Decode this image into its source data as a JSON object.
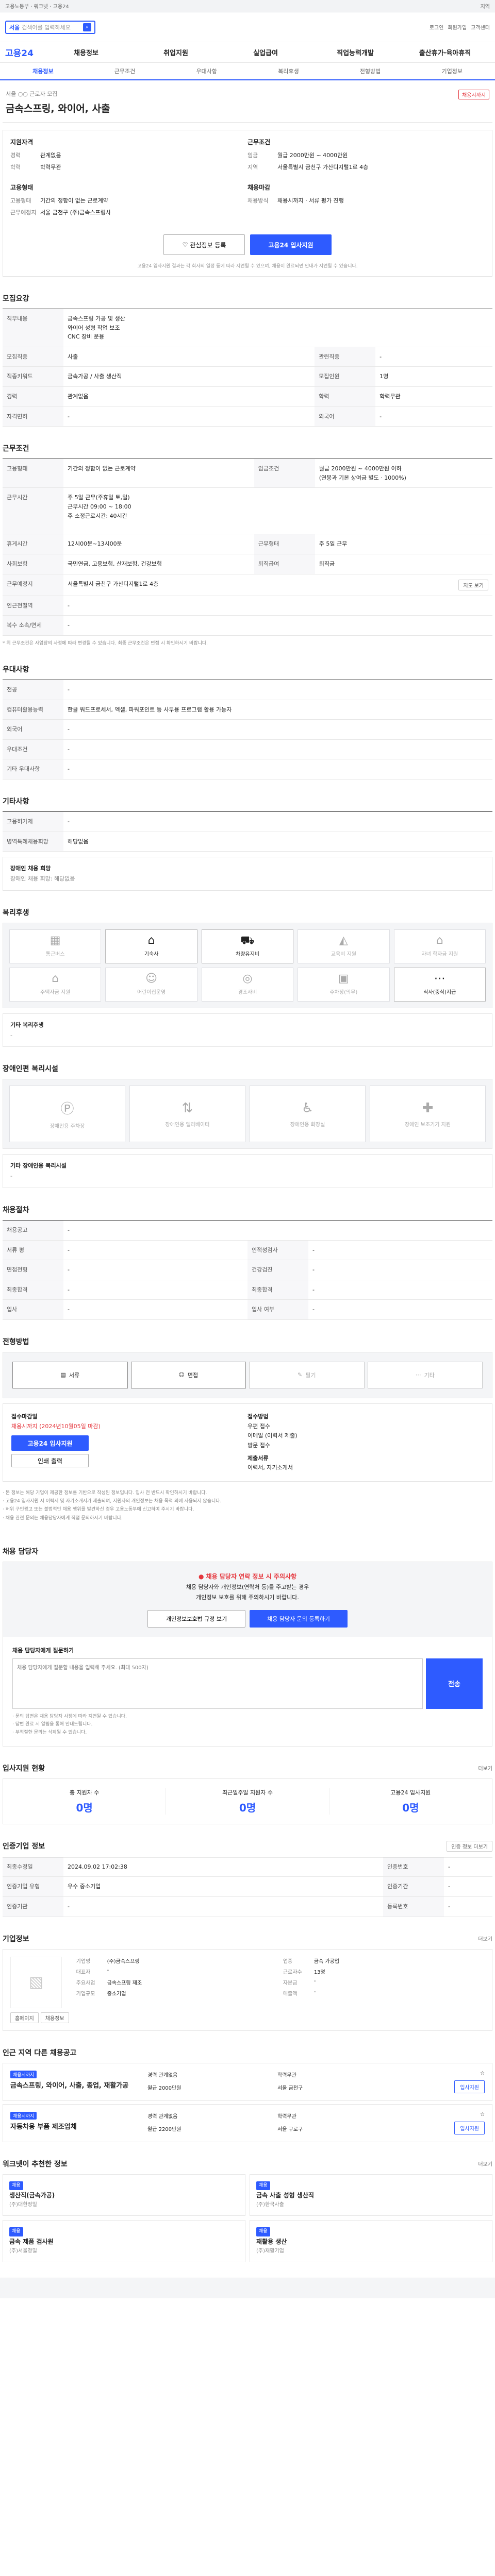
{
  "topbar": {
    "label": "고용노동부 · 워크넷 · 고용24",
    "region_link": "지역"
  },
  "search": {
    "placeholder": "검색어를 입력하세요",
    "region_tag": "서울",
    "right_links": [
      "로그인",
      "회원가입",
      "고객센터"
    ]
  },
  "gnb": {
    "logo": "고용24",
    "items": [
      "채용정보",
      "취업지원",
      "실업급여",
      "직업능력개발",
      "출산휴가·육아휴직"
    ]
  },
  "subtabs": {
    "items": [
      "채용정보",
      "근무조건",
      "우대사항",
      "복리후생",
      "전형방법",
      "기업정보"
    ],
    "active": 0
  },
  "header": {
    "company": "서울 ○○ 근로자 모집",
    "title": "금속스프링, 와이어, 사출",
    "badge": "채용시까지"
  },
  "summary": {
    "left_title": "지원자격",
    "left": [
      {
        "k": "경력",
        "v": "관계없음"
      },
      {
        "k": "학력",
        "v": "학력무관"
      }
    ],
    "left_title2": "고용형태",
    "left2": [
      {
        "k": "고용형태",
        "v": "기간의 정함이 없는 근로계약"
      },
      {
        "k": "근무예정지",
        "v": "서울 금천구 (주)금속스프링사"
      }
    ],
    "right_title": "근무조건",
    "right": [
      {
        "k": "임금",
        "v": "월급 2000만원 ~ 4000만원"
      },
      {
        "k": "지역",
        "v": "서울특별시 금천구 가산디지털1로 4층"
      }
    ],
    "right_title2": "채용마감",
    "right2": [
      {
        "k": "채용방식",
        "v": "채용시까지 · 서류 평가 진행"
      }
    ]
  },
  "buttons": {
    "fav": "관심정보 등록",
    "apply": "고용24 입사지원"
  },
  "notice": "고용24 입사지원 결과는 각 회사의 일정 등에 따라 지연될 수 있으며, 채용이 완료되면 안내가 지연될 수 있습니다.",
  "sec_recruit": {
    "title": "모집요강",
    "rows": [
      {
        "k": "직무내용",
        "v": "금속스프링 가공 및 생산\n와이어 성형 작업 보조\nCNC 장비 운용"
      },
      {
        "k": "모집직종",
        "v": "사출"
      },
      {
        "k": "관련직종",
        "v": "-"
      },
      {
        "k": "직종키워드",
        "v": "금속가공 / 사출 생산직"
      },
      {
        "k": "모집인원",
        "v": "1명"
      },
      {
        "k": "경력",
        "v": "관계없음"
      },
      {
        "k": "학력",
        "v": "학력무관"
      },
      {
        "k": "자격면허",
        "v": "-"
      },
      {
        "k": "외국어",
        "v": "-"
      }
    ]
  },
  "sec_cond": {
    "title": "근무조건",
    "rows": [
      {
        "k": "고용형태",
        "v": "기간의 정함이 없는 근로계약"
      },
      {
        "k": "임금조건",
        "v": "월급 2000만원 ~ 4000만원 이하\n(연봉과 기본 상여금 별도 · 1000%)"
      },
      {
        "k": "근무시간",
        "v": "주 5일 근무(주휴일 토,일)\n근무시간 09:00 ~ 18:00\n주 소정근로시간: 40시간"
      },
      {
        "k": "휴게시간",
        "v": "12시00분~13시00분"
      },
      {
        "k": "근무형태",
        "v": "주 5일 근무"
      },
      {
        "k": "사회보험",
        "v": "국민연금, 고용보험, 산재보험, 건강보험"
      },
      {
        "k": "퇴직급여",
        "v": "퇴직금"
      },
      {
        "k": "근무예정지",
        "v": "서울특별시 금천구 가산디지털1로 4층"
      },
      {
        "k": "인근전철역",
        "v": "-"
      },
      {
        "k": "복수 소속/면세",
        "v": "-"
      }
    ],
    "map_btn": "지도 보기",
    "foot": "* 위 근무조건은 사업장의 사정에 따라 변경될 수 있습니다. 최종 근무조건은 면접 시 확인하시기 바랍니다."
  },
  "sec_pref": {
    "title": "우대사항",
    "rows": [
      {
        "k": "전공",
        "v": "-"
      },
      {
        "k": "컴퓨터활용능력",
        "v": "한글 워드프로세서, 엑셀, 파워포인트 등 사무용 프로그램 활용 가능자"
      },
      {
        "k": "외국어",
        "v": "-"
      },
      {
        "k": "우대조건",
        "v": "-"
      },
      {
        "k": "기타 우대사항",
        "v": "-"
      }
    ]
  },
  "sec_etc": {
    "title": "기타사항",
    "rows": [
      {
        "k": "고용허가제",
        "v": "-"
      },
      {
        "k": "병역특례채용희망",
        "v": "해당없음"
      }
    ],
    "box_title": "장애인 채용 희망",
    "box_line": "장애인 채용 희망: 해당없음"
  },
  "sec_welfare": {
    "title": "복리후생",
    "tiles": [
      {
        "icon": "building-icon",
        "label": "통근버스",
        "on": false
      },
      {
        "icon": "bed-icon",
        "label": "기숙사",
        "on": true
      },
      {
        "icon": "car-icon",
        "label": "차량유지비",
        "on": true
      },
      {
        "icon": "cap-icon",
        "label": "교육비 지원",
        "on": false
      },
      {
        "icon": "home-icon",
        "label": "자녀 학자금 지원",
        "on": false
      },
      {
        "icon": "house-icon",
        "label": "주택자금 지원",
        "on": false
      },
      {
        "icon": "child-icon",
        "label": "어린이집운영",
        "on": false
      },
      {
        "icon": "coin-icon",
        "label": "경조사비",
        "on": false
      },
      {
        "icon": "box-icon",
        "label": "주차장(의무)",
        "on": false
      },
      {
        "icon": "dots-icon",
        "label": "식사(중식)지급",
        "on": true
      }
    ],
    "etc_title": "기타 복리후생",
    "etc": "-"
  },
  "sec_disabled": {
    "title": "장애인편 복리시설",
    "tiles": [
      "장애인용 주차장",
      "장애인용 엘리베이터",
      "장애인용 화장실",
      "장애인 보조기기 지원"
    ],
    "etc_title": "기타 장애인용 복리시설",
    "etc": "-"
  },
  "sec_process": {
    "title": "채용절차",
    "rows": [
      {
        "k": "채용공고",
        "v": "-"
      },
      {
        "k": "서류 평",
        "v": "-"
      },
      {
        "k": "면접전형",
        "v": "-"
      },
      {
        "k": "최종합격",
        "v": "-"
      },
      {
        "k": "입사",
        "v": "-"
      },
      {
        "k": "기타",
        "v": "-"
      }
    ],
    "cols2": [
      {
        "k": "인적성검사",
        "v": "-"
      },
      {
        "k": "건강검진",
        "v": "-"
      },
      {
        "k": "최종합격",
        "v": "-"
      },
      {
        "k": "입사 여부",
        "v": "-"
      }
    ]
  },
  "sec_method": {
    "title": "전형방법",
    "modes": [
      {
        "label": "서류",
        "on": true
      },
      {
        "label": "면접",
        "on": true
      },
      {
        "label": "필기",
        "on": false
      },
      {
        "label": "기타",
        "on": false
      }
    ]
  },
  "sec_apply": {
    "left_title": "접수마감일",
    "deadline": "채용시까지 (2024년10월05일 마감)",
    "apply_btn": "고용24 입사지원",
    "print_btn": "인쇄 출력",
    "right_title": "접수방법",
    "right_lines": [
      "우편 접수",
      "이메일 (이력서 제출)",
      "방문 접수"
    ],
    "right_title2": "제출서류",
    "right_docs": "이력서, 자기소개서"
  },
  "tips": [
    "· 본 정보는 해당 기업이 제공한 정보를 기반으로 작성된 정보입니다. 입사 전 반드시 확인하시기 바랍니다.",
    "· 고용24 입사지원 시 이력서 및 자기소개서가 제출되며, 지원자의 개인정보는 채용 목적 외에 사용되지 않습니다.",
    "· 허위 구인광고 또는 불법적인 채용 행위를 발견하신 경우 고용노동부에 신고하여 주시기 바랍니다.",
    "· 채용 관련 문의는 채용담당자에게 직접 문의하시기 바랍니다."
  ],
  "sec_qa": {
    "title": "채용 담당자",
    "warn": "채용 담당자 연락 정보 시 주의사항",
    "lines": [
      "채용 담당자와 개인정보(연락처 등)를 주고받는 경우",
      "개인정보 보호를 위해 주의하시기 바랍니다."
    ],
    "btn1": "개인정보보호법 규정 보기",
    "btn2": "채용 담당자 문의 등록하기",
    "form_title": "채용 담당자에게 질문하기",
    "placeholder": "채용 담당자에게 질문할 내용을 입력해 주세요. (최대 500자)",
    "send": "전송",
    "notes": [
      "· 문의 답변은 채용 담당자 사정에 따라 지연될 수 있습니다.",
      "· 답변 완료 시 알림을 통해 안내드립니다.",
      "· 부적절한 문의는 삭제될 수 있습니다."
    ]
  },
  "sec_stat": {
    "title": "입사지원 현황",
    "more": "더보기",
    "items": [
      {
        "k": "총 지원자 수",
        "v": "0명"
      },
      {
        "k": "최근일주일 지원자 수",
        "v": "0명"
      },
      {
        "k": "고용24 입사지원",
        "v": "0명"
      }
    ]
  },
  "sec_info": {
    "title": "인증기업 정보",
    "more": "인증 정보 더보기",
    "rows": [
      {
        "k": "최종수정일",
        "v": "2024.09.02 17:02:38",
        "k2": "인증번호",
        "v2": "-"
      },
      {
        "k": "인증기업 유형",
        "v": "우수 중소기업",
        "k2": "인증기간",
        "v2": "-"
      },
      {
        "k": "인증기관",
        "v": "-",
        "k2": "등록번호",
        "v2": "-"
      }
    ]
  },
  "sec_company": {
    "title": "기업정보",
    "more": "더보기",
    "rows": [
      {
        "k": "기업명",
        "v": "(주)금속스프링"
      },
      {
        "k": "업종",
        "v": "금속 가공업"
      },
      {
        "k": "대표자",
        "v": "-"
      },
      {
        "k": "근로자수",
        "v": "13명"
      },
      {
        "k": "주요사업",
        "v": "금속스프링 제조"
      },
      {
        "k": "자본금",
        "v": "-"
      },
      {
        "k": "기업규모",
        "v": "중소기업"
      },
      {
        "k": "매출액",
        "v": "-"
      }
    ],
    "btns": [
      "홈페이지",
      "채용정보"
    ]
  },
  "sec_same": {
    "title": "인근 지역 다른 채용공고",
    "items": [
      {
        "tag": "채용시까지",
        "title": "금속스프링, 와이어, 사출, 종업, 재활가공",
        "info": [
          "경력 관계없음",
          "학력무관",
          "월급 2000만원",
          "서울 금천구"
        ],
        "btn": "입사지원"
      },
      {
        "tag": "채용시까지",
        "title": "자동차용 부품 제조업체",
        "info": [
          "경력 관계없음",
          "학력무관",
          "월급 2200만원",
          "서울 구로구"
        ],
        "btn": "입사지원"
      }
    ]
  },
  "sec_reco": {
    "title": "워크넷이 추천한 정보",
    "more": "더보기",
    "items": [
      {
        "tag": "채용",
        "title": "생산직(금속가공)",
        "co": "(주)대한정밀"
      },
      {
        "tag": "채용",
        "title": "금속 사출 성형 생산직",
        "co": "(주)한국사출"
      },
      {
        "tag": "채용",
        "title": "금속 제품 검사원",
        "co": "(주)서울정밀"
      },
      {
        "tag": "채용",
        "title": "재활용 생산",
        "co": "(주)재활기업"
      }
    ]
  }
}
